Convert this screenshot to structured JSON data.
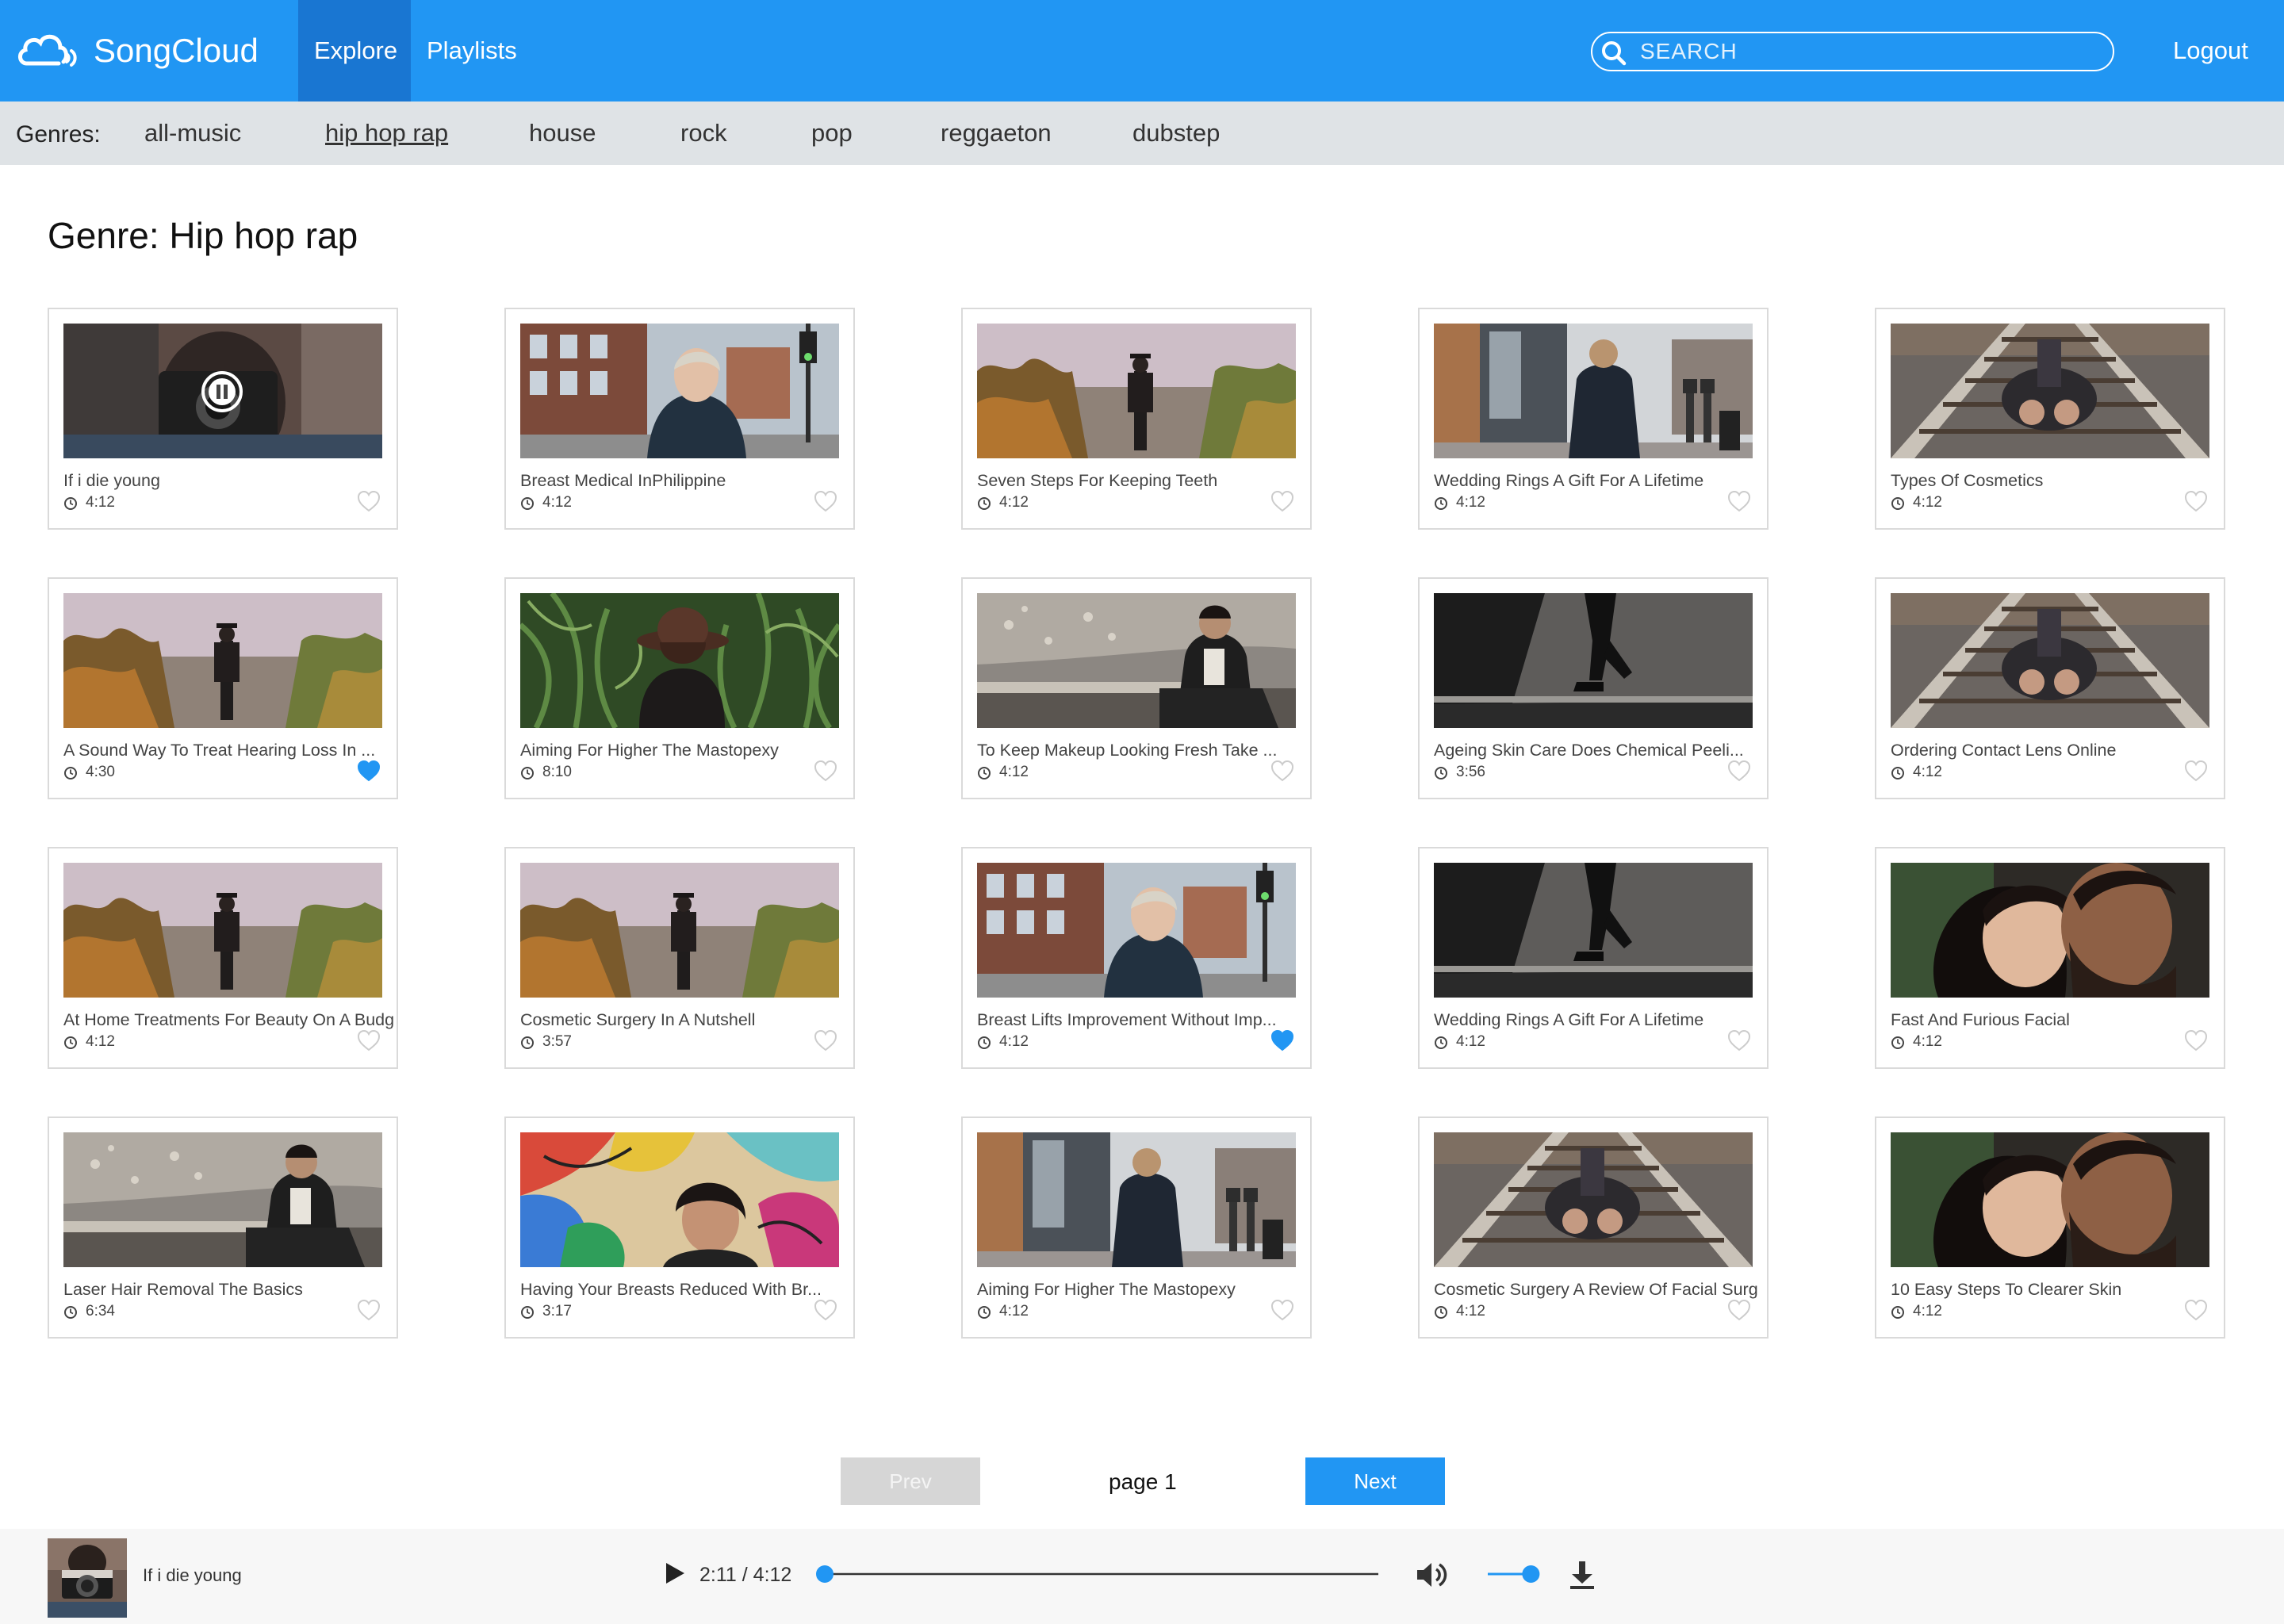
{
  "app": {
    "title": "SongCloud"
  },
  "nav": {
    "tabs": [
      "Explore",
      "Playlists"
    ],
    "active_tab": "Explore",
    "logout_label": "Logout"
  },
  "search": {
    "placeholder": "SEARCH",
    "value": ""
  },
  "genres": {
    "label": "Genres:",
    "items": [
      "all-music",
      "hip hop rap",
      "house",
      "rock",
      "pop",
      "reggaeton",
      "dubstep"
    ],
    "active": "hip hop rap"
  },
  "page": {
    "heading": "Genre: Hip hop rap"
  },
  "songs": [
    {
      "title": "If i die young",
      "duration": "4:12",
      "liked": false,
      "playing": true,
      "thumb": "camera"
    },
    {
      "title": "Breast Medical InPhilippine",
      "duration": "4:12",
      "liked": false,
      "thumb": "street"
    },
    {
      "title": "Seven Steps For Keeping Teeth",
      "duration": "4:12",
      "liked": false,
      "thumb": "forest"
    },
    {
      "title": "Wedding Rings A Gift For A Lifetime",
      "duration": "4:12",
      "liked": false,
      "thumb": "walk"
    },
    {
      "title": "Types Of Cosmetics",
      "duration": "4:12",
      "liked": false,
      "thumb": "tracks"
    },
    {
      "title": "A Sound Way To Treat Hearing Loss In ...",
      "duration": "4:30",
      "liked": true,
      "thumb": "forest"
    },
    {
      "title": "Aiming For Higher The Mastopexy",
      "duration": "8:10",
      "liked": false,
      "thumb": "corn"
    },
    {
      "title": "To Keep Makeup Looking Fresh Take ...",
      "duration": "4:12",
      "liked": false,
      "thumb": "rocks"
    },
    {
      "title": "Ageing Skin Care Does Chemical Peeli...",
      "duration": "3:56",
      "liked": false,
      "thumb": "stairs"
    },
    {
      "title": "Ordering Contact Lens Online",
      "duration": "4:12",
      "liked": false,
      "thumb": "tracks"
    },
    {
      "title": "At Home Treatments For Beauty On A Budg",
      "duration": "4:12",
      "liked": false,
      "thumb": "forest"
    },
    {
      "title": "Cosmetic Surgery In A Nutshell",
      "duration": "3:57",
      "liked": false,
      "thumb": "forest"
    },
    {
      "title": "Breast Lifts Improvement Without Imp...",
      "duration": "4:12",
      "liked": true,
      "thumb": "street"
    },
    {
      "title": "Wedding Rings A Gift For A Lifetime",
      "duration": "4:12",
      "liked": false,
      "thumb": "stairs"
    },
    {
      "title": "Fast And Furious Facial",
      "duration": "4:12",
      "liked": false,
      "thumb": "couple"
    },
    {
      "title": "Laser Hair Removal The Basics",
      "duration": "6:34",
      "liked": false,
      "thumb": "rocks"
    },
    {
      "title": "Having Your Breasts Reduced With Br...",
      "duration": "3:17",
      "liked": false,
      "thumb": "graffiti"
    },
    {
      "title": "Aiming For Higher The Mastopexy",
      "duration": "4:12",
      "liked": false,
      "thumb": "walk"
    },
    {
      "title": "Cosmetic Surgery A Review Of Facial Surg",
      "duration": "4:12",
      "liked": false,
      "thumb": "tracks"
    },
    {
      "title": "10 Easy Steps To Clearer Skin",
      "duration": "4:12",
      "liked": false,
      "thumb": "couple"
    }
  ],
  "pagination": {
    "prev_label": "Prev",
    "next_label": "Next",
    "page_label": "page 1",
    "prev_enabled": false
  },
  "player": {
    "title": "If i die young",
    "current_time": "2:11",
    "separator": "/",
    "total_time": "4:12",
    "progress": 0.0,
    "volume": 0.85
  },
  "colors": {
    "accent": "#2196f3",
    "accent_dark": "#1976d2",
    "genre_bar": "#dfe3e6",
    "liked": "#2196f3",
    "unliked": "#cccccc"
  },
  "icons": {
    "logo": "cloud-sound-icon",
    "search": "search-icon",
    "clock": "clock-icon",
    "heart": "heart-icon",
    "pause": "pause-icon",
    "play": "play-icon",
    "volume": "volume-icon",
    "download": "download-icon"
  }
}
